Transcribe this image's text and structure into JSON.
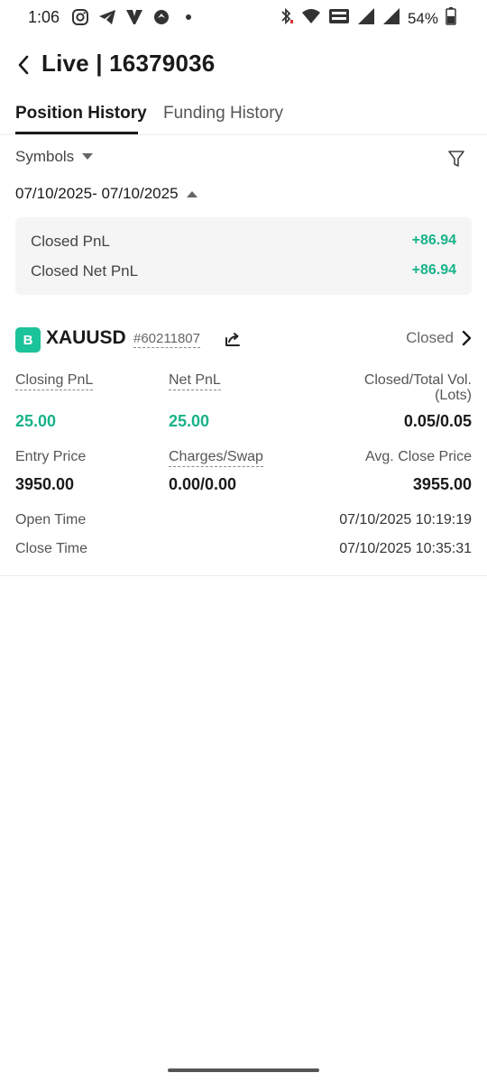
{
  "status_bar": {
    "time": "1:06",
    "battery_percent": "54%",
    "left_icons": [
      "instagram-icon",
      "telegram-icon",
      "v-app-icon",
      "maps-icon",
      "dot-icon"
    ],
    "right_icons": [
      "bluetooth-icon",
      "wifi-icon",
      "volte-icon",
      "signal-icon",
      "signal-icon",
      "battery-icon"
    ]
  },
  "header": {
    "title": "Live | 16379036"
  },
  "tabs": [
    {
      "label": "Position History",
      "active": true
    },
    {
      "label": "Funding History",
      "active": false
    }
  ],
  "filters": {
    "symbols_label": "Symbols",
    "date_range": "07/10/2025- 07/10/2025"
  },
  "summary": {
    "closed_pnl_label": "Closed PnL",
    "closed_pnl_value": "+86.94",
    "closed_net_pnl_label": "Closed Net PnL",
    "closed_net_pnl_value": "+86.94"
  },
  "position": {
    "side_badge": "B",
    "symbol": "XAUUSD",
    "order_id": "#60211807",
    "status": "Closed",
    "closing_pnl_label": "Closing PnL",
    "closing_pnl_value": "25.00",
    "net_pnl_label": "Net PnL",
    "net_pnl_value": "25.00",
    "volume_label_line1": "Closed/Total Vol.",
    "volume_label_line2": "(Lots)",
    "volume_value": "0.05/0.05",
    "entry_price_label": "Entry Price",
    "entry_price_value": "3950.00",
    "charges_label": "Charges/Swap",
    "charges_value": "0.00/0.00",
    "avg_close_label": "Avg. Close Price",
    "avg_close_value": "3955.00",
    "open_time_label": "Open Time",
    "open_time_value": "07/10/2025 10:19:19",
    "close_time_label": "Close Time",
    "close_time_value": "07/10/2025 10:35:31"
  },
  "colors": {
    "accent_green": "#18b38a",
    "badge_green": "#1bc39a"
  }
}
